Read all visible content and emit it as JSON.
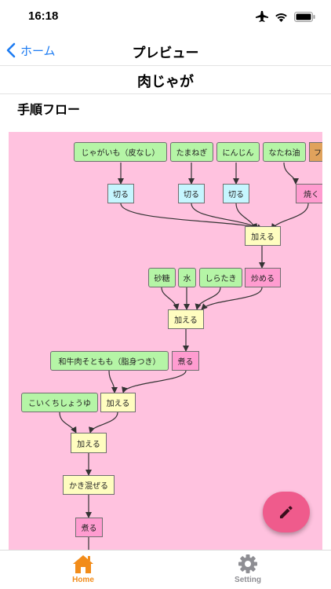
{
  "status_bar": {
    "time": "16:18"
  },
  "nav": {
    "back_label": "ホーム",
    "title": "プレビュー"
  },
  "recipe": {
    "title": "肉じゃが"
  },
  "flow": {
    "heading": "手順フロー",
    "nodes": {
      "potato": "じゃがいも（皮なし）",
      "onion": "たまねぎ",
      "carrot": "にんじん",
      "rapeseed_oil": "なたね油",
      "partial": "フ",
      "cut1": "切る",
      "cut2": "切る",
      "cut3": "切る",
      "bake": "焼く",
      "add1": "加える",
      "sugar": "砂糖",
      "water": "水",
      "shirataki": "しらたき",
      "stirfry": "炒める",
      "add2": "加える",
      "beef": "和牛肉そともも（脂身つき）",
      "simmer1": "煮る",
      "soy": "こいくちしょうゆ",
      "add3": "加える",
      "add4": "加える",
      "mix": "かき混ぜる",
      "simmer2": "煮る"
    }
  },
  "tabs": {
    "home": "Home",
    "setting": "Setting"
  },
  "colors": {
    "flow_background": "#ffc2df",
    "ingredient": "#b5f5a6",
    "cut": "#c6f6ff",
    "add": "#fffdc0",
    "heat": "#ff9cd0",
    "fab": "#ef5b8c",
    "accent": "#1d7cf2",
    "tab_active": "#f28c1a"
  },
  "icons": {
    "back": "chevron-left-icon",
    "airplane": "airplane-icon",
    "wifi": "wifi-icon",
    "battery": "battery-icon",
    "edit": "pencil-icon",
    "home": "home-icon",
    "setting": "gear-icon"
  }
}
